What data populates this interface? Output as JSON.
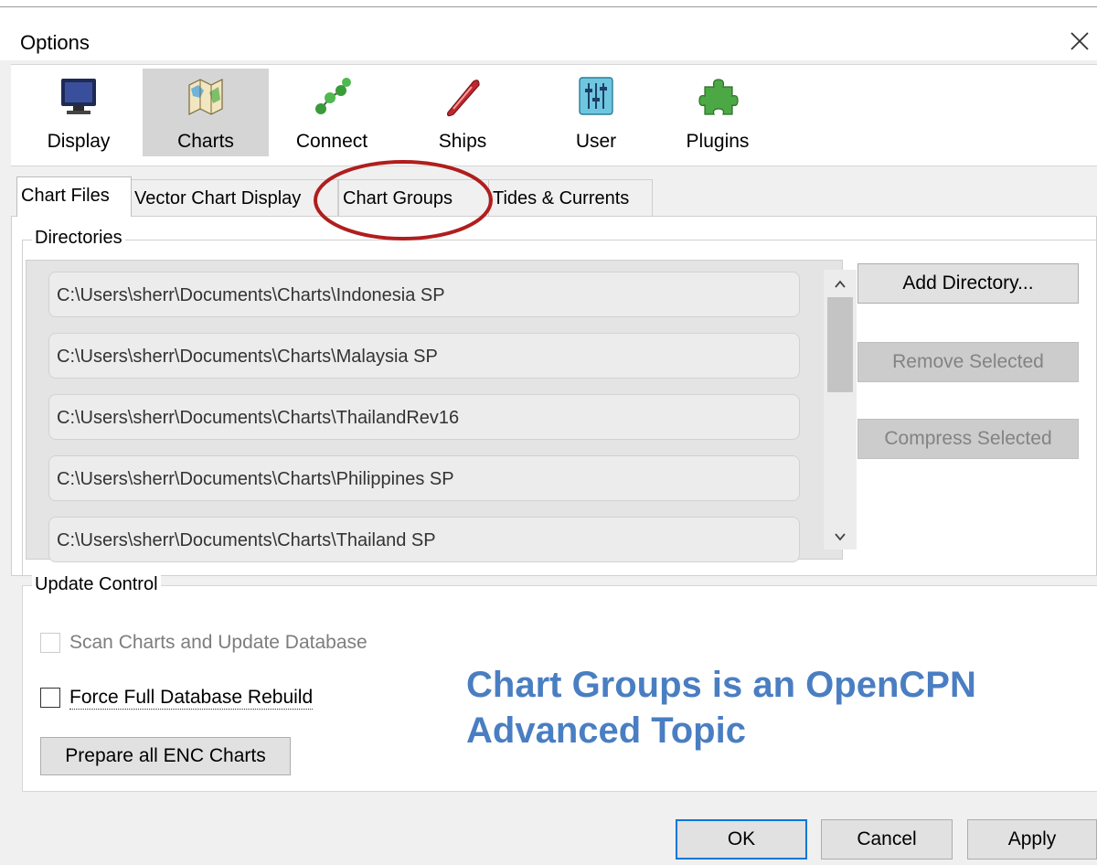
{
  "window": {
    "title": "Options"
  },
  "toolbar": {
    "items": [
      {
        "label": "Display",
        "icon": "monitor-icon"
      },
      {
        "label": "Charts",
        "icon": "chart-map-icon",
        "selected": true
      },
      {
        "label": "Connect",
        "icon": "connect-nodes-icon"
      },
      {
        "label": "Ships",
        "icon": "ship-icon"
      },
      {
        "label": "User",
        "icon": "sliders-icon"
      },
      {
        "label": "Plugins",
        "icon": "puzzle-icon"
      }
    ]
  },
  "tabs": [
    {
      "label": "Chart Files",
      "active": true
    },
    {
      "label": "Vector Chart Display"
    },
    {
      "label": "Chart Groups"
    },
    {
      "label": "Tides & Currents"
    }
  ],
  "directories": {
    "title": "Directories",
    "items": [
      "C:\\Users\\sherr\\Documents\\Charts\\Indonesia SP",
      "C:\\Users\\sherr\\Documents\\Charts\\Malaysia SP",
      "C:\\Users\\sherr\\Documents\\Charts\\ThailandRev16",
      "C:\\Users\\sherr\\Documents\\Charts\\Philippines SP",
      "C:\\Users\\sherr\\Documents\\Charts\\Thailand SP"
    ],
    "buttons": {
      "add": "Add Directory...",
      "remove": "Remove Selected",
      "compress": "Compress Selected"
    }
  },
  "update_control": {
    "title": "Update Control",
    "scan_label": "Scan Charts and Update Database",
    "scan_checked": false,
    "rebuild_label": "Force Full Database Rebuild",
    "rebuild_checked": false,
    "prepare_label": "Prepare all ENC Charts"
  },
  "annotation": {
    "line1": "Chart Groups is an OpenCPN",
    "line2": "Advanced Topic",
    "color": "#4a7ec2",
    "circle_color": "#b01e1e"
  },
  "dialog_buttons": {
    "ok": "OK",
    "cancel": "Cancel",
    "apply": "Apply"
  }
}
